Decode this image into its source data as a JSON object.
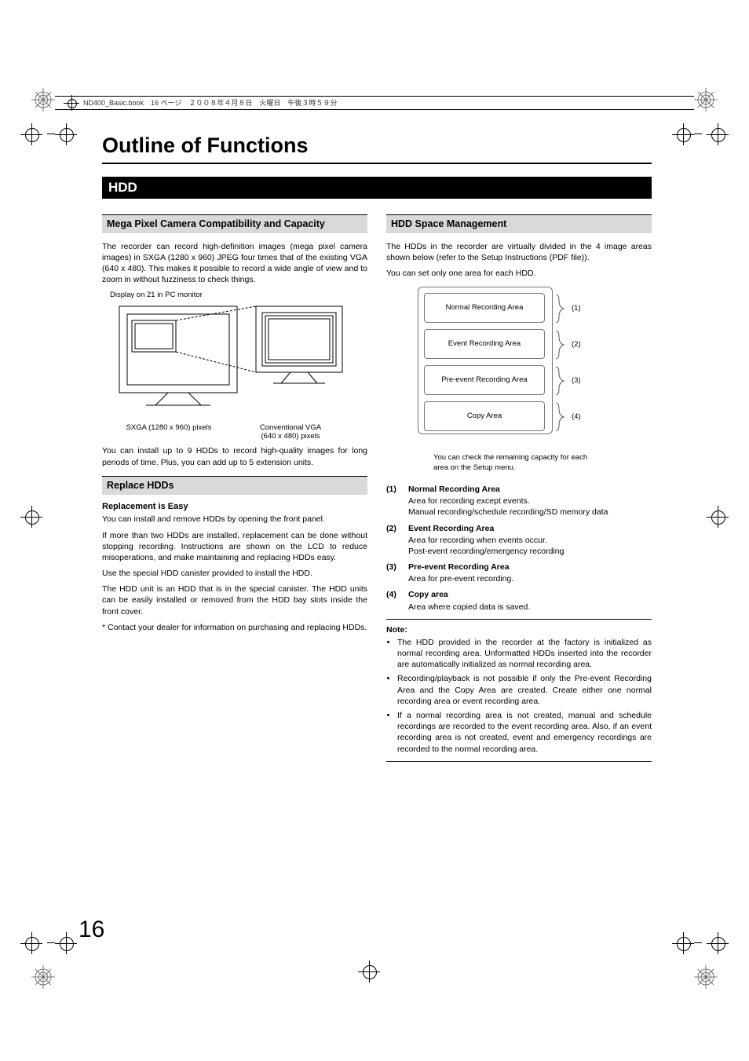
{
  "header_strip": "ND400_Basic.book　16 ページ　２００８年４月８日　火曜日　午後３時５９分",
  "title": "Outline of Functions",
  "section": "HDD",
  "page_number": "16",
  "left": {
    "sub1_title": "Mega Pixel Camera Compatibility and Capacity",
    "sub1_body": "The recorder can record high-definition images (mega pixel camera images) in SXGA (1280 x 960) JPEG four times that of the existing VGA (640 x 480). This makes it possible to record a wide angle of view and to zoom in without fuzziness to check things.",
    "fig_caption_top": "Display on 21 in PC monitor",
    "fig_caption_l": "SXGA (1280 x 960) pixels",
    "fig_caption_r1": "Conventional VGA",
    "fig_caption_r2": "(640 x 480) pixels",
    "sub1_tail": "You can install up to 9 HDDs to record high-quality images for long periods of time. Plus, you can add up to 5 extension units.",
    "sub2_title": "Replace HDDs",
    "sub2_h": "Replacement is Easy",
    "sub2_p1": "You can install and remove HDDs by opening the front panel.",
    "sub2_p2": "If more than two HDDs are installed, replacement can be done without stopping recording. Instructions are shown on the LCD to reduce misoperations, and make maintaining and replacing HDDs easy.",
    "sub2_p3": "Use the special HDD canister provided to install the HDD.",
    "sub2_p4": "The HDD unit is an HDD that is in the special canister. The HDD units can be easily installed or removed from the HDD bay slots inside the front cover.",
    "sub2_p5": "*  Contact your dealer for information on purchasing and replacing HDDs."
  },
  "right": {
    "sub_title": "HDD Space Management",
    "intro1": "The HDDs in the recorder are virtually divided in the 4 image areas shown below (refer to the Setup Instructions (PDF file)).",
    "intro2": "You can set only one area for each HDD.",
    "diag": {
      "a1": "Normal Recording Area",
      "a2": "Event Recording Area",
      "a3": "Pre-event Recording Area",
      "a4": "Copy Area",
      "n1": "(1)",
      "n2": "(2)",
      "n3": "(3)",
      "n4": "(4)",
      "cap": "You can check the remaining capacity for each area on the Setup menu."
    },
    "list": [
      {
        "num": "(1)",
        "t": "Normal Recording Area",
        "d": "Area for recording except events.\nManual recording/schedule recording/SD memory data"
      },
      {
        "num": "(2)",
        "t": "Event Recording Area",
        "d": "Area for recording when events occur.\nPost-event recording/emergency recording"
      },
      {
        "num": "(3)",
        "t": "Pre-event Recording Area",
        "d": "Area for pre-event recording."
      },
      {
        "num": "(4)",
        "t": "Copy area",
        "d": "Area where copied data is saved."
      }
    ],
    "note_label": "Note:",
    "notes": [
      "The HDD provided in the recorder at the factory is initialized as normal recording area. Unformatted HDDs inserted into the recorder are automatically initialized as normal recording area.",
      "Recording/playback is not possible if only the Pre-event Recording Area and the Copy Area are created. Create either one normal recording area or event recording area.",
      "If a normal recording area is not created, manual and schedule recordings are recorded to the event recording area. Also, if an event recording area is not created, event and emergency recordings are recorded to the normal recording area."
    ]
  }
}
